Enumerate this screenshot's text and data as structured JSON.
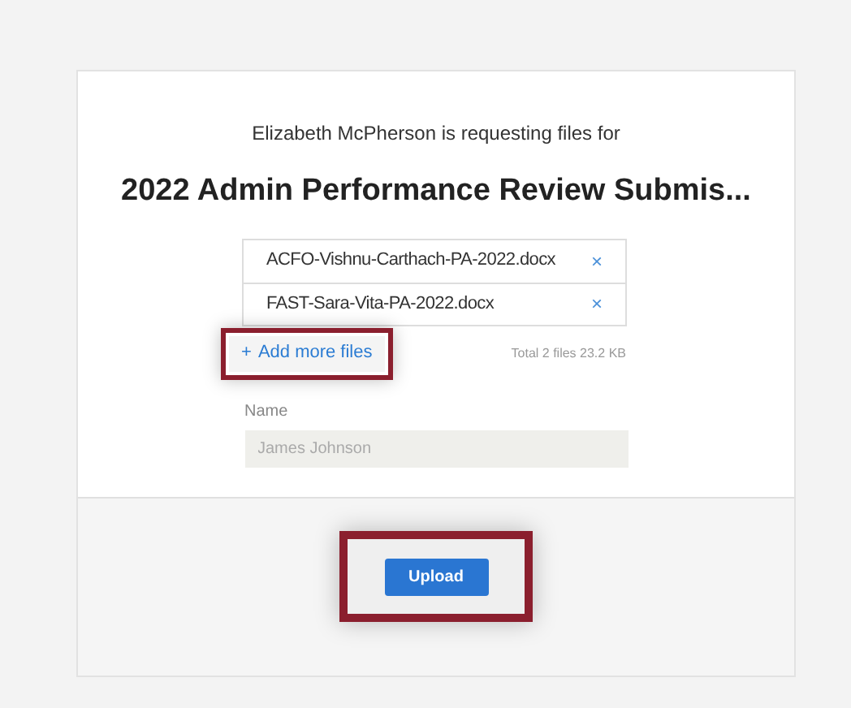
{
  "request": {
    "subtitle": "Elizabeth McPherson is requesting files for",
    "title": "2022 Admin Performance Review Submis..."
  },
  "files": [
    {
      "name": "ACFO-Vishnu-Carthach-PA-2022.docx",
      "remove": "×"
    },
    {
      "name": "FAST-Sara-Vita-PA-2022.docx",
      "remove": "×"
    }
  ],
  "add_more": {
    "icon": "+",
    "label": "Add more files",
    "highlighted": true
  },
  "total": "Total 2 files 23.2 KB",
  "name_field": {
    "label": "Name",
    "placeholder": "James Johnson"
  },
  "upload": {
    "label": "Upload",
    "highlighted": true
  }
}
